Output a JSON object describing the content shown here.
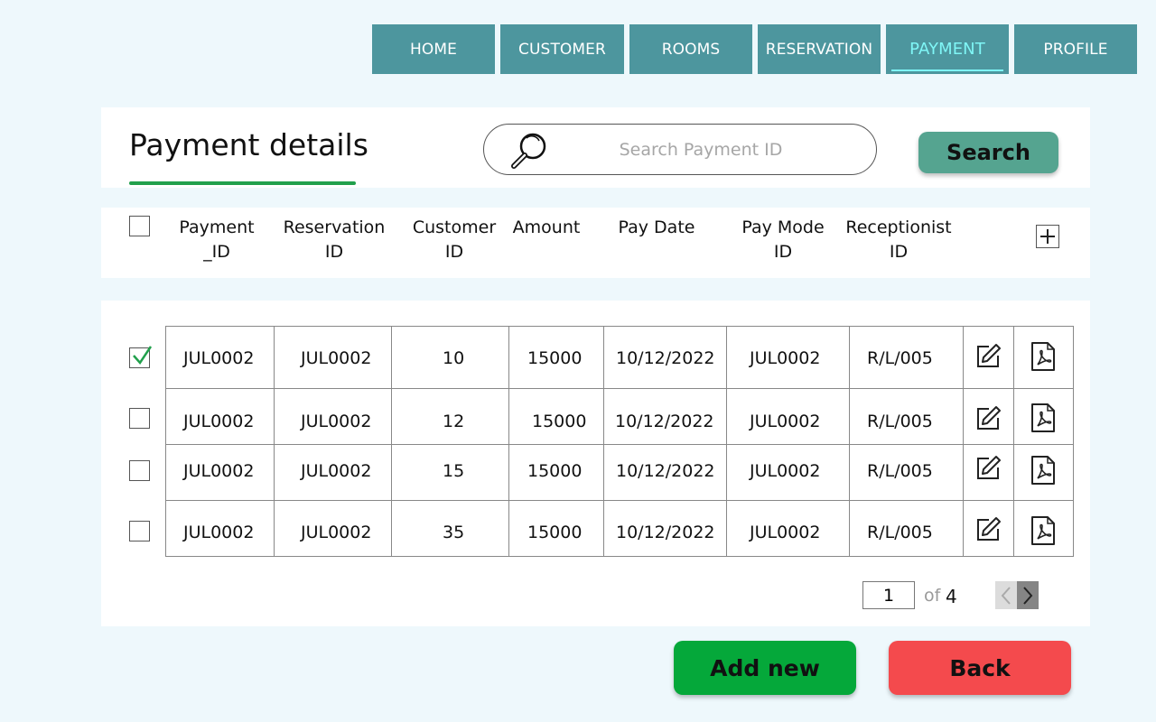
{
  "nav": {
    "tabs": [
      {
        "label": "HOME"
      },
      {
        "label": "CUSTOMER"
      },
      {
        "label": "ROOMS"
      },
      {
        "label": "RESERVATION"
      },
      {
        "label": "PAYMENT",
        "active": true
      },
      {
        "label": "PROFILE"
      }
    ]
  },
  "header": {
    "title": "Payment details",
    "search_placeholder": "Search Payment ID",
    "search_value": "",
    "search_button": "Search"
  },
  "table": {
    "columns": [
      {
        "line1": "Payment",
        "line2": "_ID"
      },
      {
        "line1": "Reservation",
        "line2": "ID"
      },
      {
        "line1": "Customer",
        "line2": "ID"
      },
      {
        "line1": "Amount",
        "line2": ""
      },
      {
        "line1": "Pay Date",
        "line2": ""
      },
      {
        "line1": "Pay Mode",
        "line2": "ID"
      },
      {
        "line1": "Receptionist",
        "line2": "ID"
      }
    ],
    "rows": [
      {
        "checked": true,
        "payment_id": "JUL0002",
        "reservation_id": "JUL0002",
        "customer_id": "10",
        "amount": "15000",
        "pay_date": "10/12/2022",
        "pay_mode_id": "JUL0002",
        "receptionist_id": "R/L/005"
      },
      {
        "checked": false,
        "payment_id": "JUL0002",
        "reservation_id": "JUL0002",
        "customer_id": "12",
        "amount": "15000",
        "pay_date": "10/12/2022",
        "pay_mode_id": "JUL0002",
        "receptionist_id": "R/L/005"
      },
      {
        "checked": false,
        "payment_id": "JUL0002",
        "reservation_id": "JUL0002",
        "customer_id": "15",
        "amount": "15000",
        "pay_date": "10/12/2022",
        "pay_mode_id": "JUL0002",
        "receptionist_id": "R/L/005"
      },
      {
        "checked": false,
        "payment_id": "JUL0002",
        "reservation_id": "JUL0002",
        "customer_id": "35",
        "amount": "15000",
        "pay_date": "10/12/2022",
        "pay_mode_id": "JUL0002",
        "receptionist_id": "R/L/005"
      }
    ]
  },
  "pagination": {
    "current": "1",
    "of_label": "of",
    "total": "4"
  },
  "actions": {
    "add_new": "Add new",
    "back": "Back"
  },
  "icons": {
    "search": "magnifier-icon",
    "add_column": "plus-icon",
    "edit": "edit-icon",
    "pdf": "pdf-icon",
    "check": "checkmark-icon",
    "prev": "chevron-left-icon",
    "next": "chevron-right-icon"
  },
  "colors": {
    "nav_bg": "#4d969e",
    "nav_active_text": "#7ff6f6",
    "title_underline": "#21a04c",
    "search_button": "#55a490",
    "add_button": "#05a83a",
    "back_button": "#f44a4d",
    "background": "#eef8fc"
  }
}
